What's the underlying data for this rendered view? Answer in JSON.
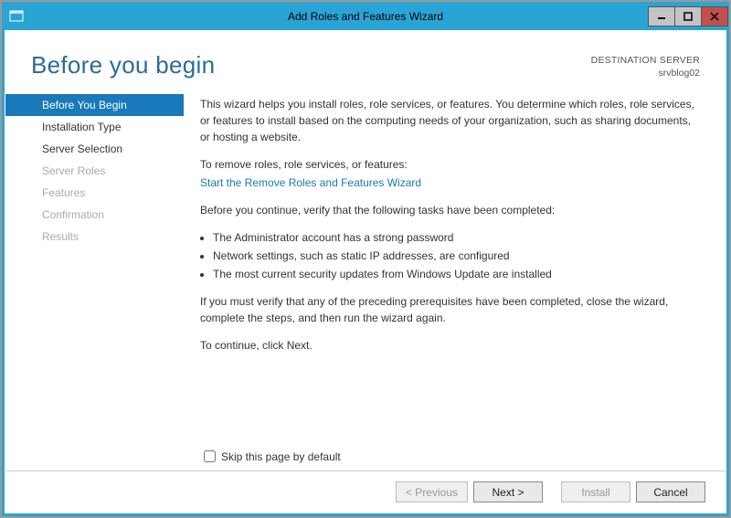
{
  "window": {
    "title": "Add Roles and Features Wizard"
  },
  "header": {
    "pageTitle": "Before you begin",
    "destLabel": "DESTINATION SERVER",
    "destServer": "srvblog02"
  },
  "nav": {
    "items": [
      {
        "label": "Before You Begin",
        "state": "active"
      },
      {
        "label": "Installation Type",
        "state": "enabled"
      },
      {
        "label": "Server Selection",
        "state": "enabled"
      },
      {
        "label": "Server Roles",
        "state": "disabled"
      },
      {
        "label": "Features",
        "state": "disabled"
      },
      {
        "label": "Confirmation",
        "state": "disabled"
      },
      {
        "label": "Results",
        "state": "disabled"
      }
    ]
  },
  "main": {
    "intro": "This wizard helps you install roles, role services, or features. You determine which roles, role services, or features to install based on the computing needs of your organization, such as sharing documents, or hosting a website.",
    "removePrompt": "To remove roles, role services, or features:",
    "removeLink": "Start the Remove Roles and Features Wizard",
    "verifyPrompt": "Before you continue, verify that the following tasks have been completed:",
    "bullets": [
      "The Administrator account has a strong password",
      "Network settings, such as static IP addresses, are configured",
      "The most current security updates from Windows Update are installed"
    ],
    "verifyNote": "If you must verify that any of the preceding prerequisites have been completed, close the wizard, complete the steps, and then run the wizard again.",
    "continueNote": "To continue, click Next.",
    "skipLabel": "Skip this page by default"
  },
  "footer": {
    "previous": "< Previous",
    "next": "Next >",
    "install": "Install",
    "cancel": "Cancel"
  }
}
